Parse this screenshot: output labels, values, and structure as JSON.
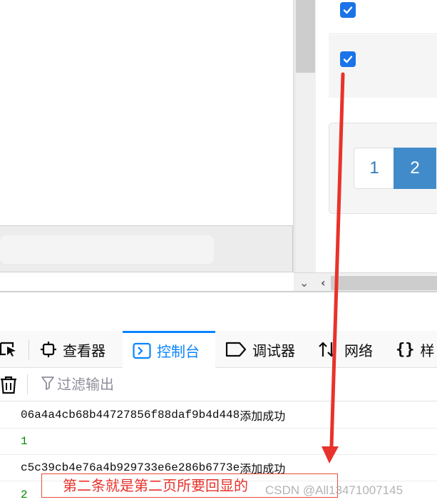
{
  "pagination": {
    "page1": "1",
    "page2": "2",
    "active_page": "2"
  },
  "devtools": {
    "tabs": [
      {
        "label": "查看器"
      },
      {
        "label": "控制台"
      },
      {
        "label": "调试器"
      },
      {
        "label": "网络"
      },
      {
        "label": "样"
      }
    ],
    "active_tab": "控制台",
    "filter_placeholder": "过滤输出"
  },
  "console": [
    {
      "id": "06a4a4cb68b44727856f88daf9b4d448",
      "msg": "添加成功"
    },
    {
      "value": "1"
    },
    {
      "id": "c5c39cb4e76a4b929733e6e286b6773e",
      "msg": " 添加成功"
    },
    {
      "value": "2"
    }
  ],
  "annotation": {
    "text": "第二条就是第二页所要回显的",
    "color": "#e8322b"
  },
  "watermark": "CSDN @All13471007145",
  "colors": {
    "accent": "#0a84ff",
    "checkbox": "#1a73e8",
    "active_page": "#428bca",
    "log_number": "#058b00"
  }
}
